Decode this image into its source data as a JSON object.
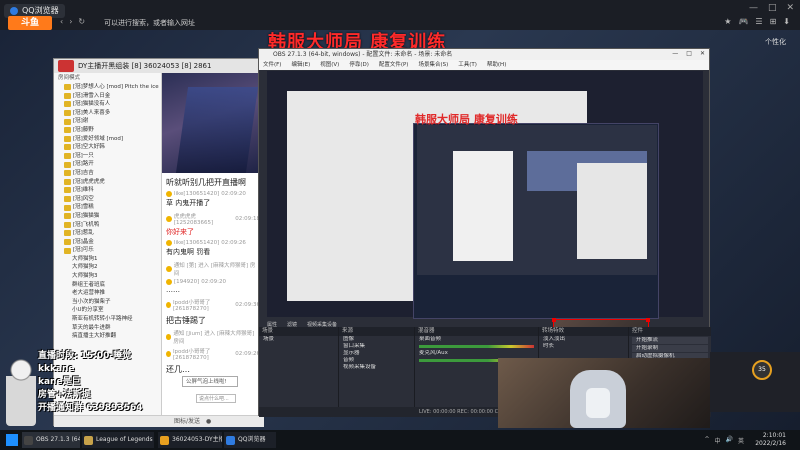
{
  "browser": {
    "tab_title": "QQ浏览器",
    "address_placeholder": "可以进行搜索，或者输入网址",
    "logo": "斗鱼",
    "custom_label": "个性化",
    "controls": [
      "—",
      "□",
      "✕"
    ],
    "nav_icons": [
      "‹",
      "›",
      "↻"
    ],
    "right_icons": [
      "★",
      "🎮",
      "☰",
      "⊞",
      "⬇"
    ]
  },
  "stream": {
    "title": "韩服大师局 康复训练"
  },
  "chat_window": {
    "title": "DY主播开黑组装 [8] 36024053 [8] 2861",
    "tree_header_left": "房间模式",
    "tree_header_right": "",
    "tree_items": [
      "[冠]梦想人心 [mod] Pitch the ice",
      "[冠]滑雪入日金",
      "[冠]猫猫没有人",
      "[冠]美人来喜多",
      "[冠]谢",
      "[冠]藤野",
      "[冠]爱好领域 [mod]",
      "[冠]空大好韩",
      "[冠]一只",
      "[冠]路开",
      "[冠]吉吉",
      "[冠]虎虎虎虎",
      "[冠]维科",
      "[冠]风空",
      "[冠]雪糕",
      "[冠]猫猫猫",
      "[冠]飞机鸭",
      "[冠]惹乱",
      "[冠]晶金",
      "[冠]可乐"
    ],
    "group_items": [
      "大师猫狗1",
      "大师猫狗2",
      "大师猫狗3",
      "群组王者班底",
      "老大运营神推",
      "当小次的猫柴子",
      "小U的分享室",
      "斯亚有机转转小平路神经",
      "草天的最牛进群",
      "搞直播主大好推翻"
    ],
    "messages": [
      {
        "kind": "big",
        "text": "听就听别几把开直播啊"
      },
      {
        "kind": "user",
        "user": "like[130651420]",
        "time": "02:09:20"
      },
      {
        "kind": "text",
        "text": "草 内鬼开播了"
      },
      {
        "kind": "user",
        "user": "虎虎虎虎[1252083665]",
        "time": "02:09:18"
      },
      {
        "kind": "red",
        "text": "你好来了"
      },
      {
        "kind": "user",
        "user": "like[130651420]",
        "time": "02:09:26"
      },
      {
        "kind": "text",
        "text": "有内鬼啊 罚看"
      },
      {
        "kind": "user",
        "user": "通知 [第] 进入 [麻辣大师猴哥] 房间",
        "time": ""
      },
      {
        "kind": "user",
        "user": "[194920]",
        "time": "02:09:20"
      },
      {
        "kind": "text",
        "text": "……"
      },
      {
        "kind": "user",
        "user": "Ipodd小哥哥了[261878270]",
        "time": "02:09:36"
      },
      {
        "kind": "big",
        "text": "把古锤踢了"
      },
      {
        "kind": "user",
        "user": "通知 [Jium] 进入 [麻辣大师猴哥] 房间",
        "time": ""
      },
      {
        "kind": "user",
        "user": "Ipodd小哥哥了[261878270]",
        "time": "02:09:26"
      },
      {
        "kind": "big",
        "text": "还几…"
      }
    ],
    "float_input": "公屏气泡上线啦!",
    "float_input2": "说点什么吧...",
    "input_bar": [
      "图标/发送",
      "●"
    ]
  },
  "obs": {
    "title": "OBS 27.1.3 (64-bit, windows) - 配置文件: 未命名 - 场景: 未命名",
    "menu": [
      "文件(F)",
      "编辑(E)",
      "视图(V)",
      "停靠(D)",
      "配置文件(P)",
      "场景集合(S)",
      "工具(T)",
      "帮助(H)"
    ],
    "nested_title": "韩服大师局 康复训练",
    "docks": {
      "scenes": "场景",
      "sources": "来源",
      "mixer": "混音器",
      "transitions": "转场特效",
      "controls": "控件"
    },
    "scene_item": "场景",
    "source_items": [
      "图像",
      "窗口采集",
      "显示器",
      "音频",
      "视频采集设备"
    ],
    "mixer_items": [
      "桌面音频",
      "麦克风/Aux"
    ],
    "transition_items": [
      "淡入淡出",
      "时长"
    ],
    "control_items": [
      "开始推流",
      "开始录制",
      "启动虚拟摄像机",
      "工作室模式",
      "设置",
      "退出"
    ],
    "toolbar": [
      "属性",
      "滤镜",
      "视频采集设备"
    ],
    "status": "LIVE: 00:00:00  REC: 00:00:00  CPU: 7.8%, 30.00 fps  kb/s: 4008"
  },
  "overlay": {
    "rows": [
      "直播时段: 15:00-睡觉",
      "kkkane",
      "kane是巨",
      "房管+法斯提",
      "开播通知群 639893564"
    ]
  },
  "side_circle": "35",
  "taskbar": {
    "items": [
      {
        "label": "OBS 27.1.3 (64-bit...",
        "color": "#444"
      },
      {
        "label": "League of Legends",
        "color": "#c7a24a"
      },
      {
        "label": "36024053-DY主播...",
        "color": "#e8a020"
      },
      {
        "label": "QQ浏览器",
        "color": "#2f7be0"
      }
    ],
    "clock_time": "2:10:01",
    "clock_date": "2022/2/16",
    "tray": [
      "^",
      "中",
      "🔊",
      "英"
    ]
  }
}
